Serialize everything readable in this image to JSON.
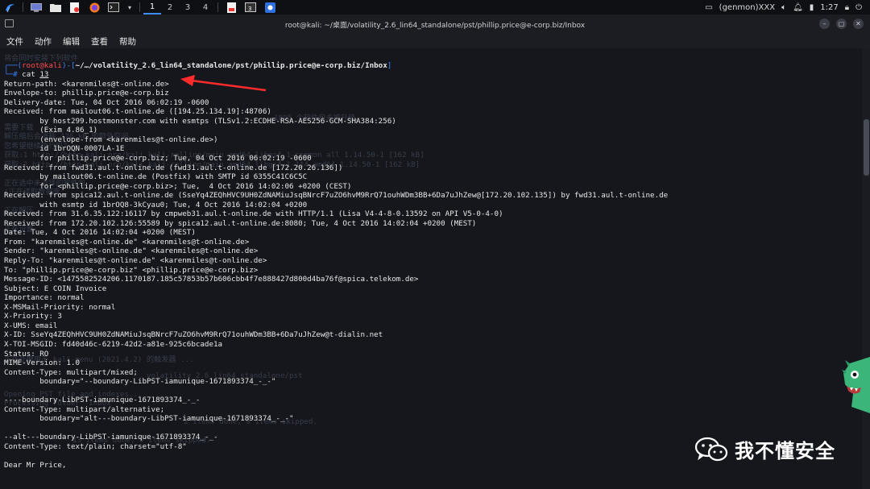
{
  "taskbar": {
    "workspaces": [
      "1",
      "2",
      "3",
      "4"
    ],
    "active_workspace": "1",
    "notif_count": "3",
    "user": "(genmon)XXX",
    "time": "1:27"
  },
  "window": {
    "title": "root@kali: ~/桌面/volatility_2.6_lin64_standalone/pst/phillip.price@e-corp.biz/Inbox"
  },
  "menu": [
    "文件",
    "动作",
    "编辑",
    "查看",
    "帮助"
  ],
  "prompt": {
    "user": "root@kali",
    "path": "~/…/volatility_2.6_lin64_standalone/pst/phillip.price@e-corp.biz/Inbox",
    "symbol": "#",
    "command": "cat",
    "argument": "13"
  },
  "output": [
    "Return-path: <karenmiles@t-online.de>",
    "Envelope-to: phillip.price@e-corp.biz",
    "Delivery-date: Tue, 04 Oct 2016 06:02:19 -0600",
    "Received: from mailout06.t-online.de ([194.25.134.19]:48706)",
    "        by host299.hostmonster.com with esmtps (TLSv1.2:ECDHE-RSA-AES256-GCM-SHA384:256)",
    "        (Exim 4.86_1)",
    "        (envelope-from <karenmiles@t-online.de>)",
    "        id 1brOQN-0007LA-1E",
    "        for phillip.price@e-corp.biz; Tue, 04 Oct 2016 06:02:19 -0600",
    "Received: from fwd31.aul.t-online.de (fwd31.aul.t-online.de [172.20.26.136])",
    "        by mailout06.t-online.de (Postfix) with SMTP id 6355C41C6C5C",
    "        for <phillip.price@e-corp.biz>; Tue,  4 Oct 2016 14:02:06 +0200 (CEST)",
    "Received: from spica12.aul.t-online.de (SseYq4ZEQhHVC9UH0ZdNAMiuJsqBNrcF7uZO6hvM9RrQ71ouhWDm3BB+6Da7uJhZew@[172.20.102.135]) by fwd31.aul.t-online.de",
    "        with esmtp id 1brOQ8-3kCyau0; Tue, 4 Oct 2016 14:02:04 +0200",
    "Received: from 31.6.35.122:16117 by cmpweb31.aul.t-online.de with HTTP/1.1 (Lisa V4-4-8-0.13592 on API V5-0-4-0)",
    "Received: from 172.20.102.126:55589 by spica12.aul.t-online.de:8080; Tue, 4 Oct 2016 14:02:04 +0200 (MEST)",
    "Date: Tue, 4 Oct 2016 14:02:04 +0200 (MEST)",
    "From: \"karenmiles@t-online.de\" <karenmiles@t-online.de>",
    "Sender: \"karenmiles@t-online.de\" <karenmiles@t-online.de>",
    "Reply-To: \"karenmiles@t-online.de\" <karenmiles@t-online.de>",
    "To: \"phillip.price@e-corp.biz\" <phillip.price@e-corp.biz>",
    "Message-ID: <1475582524206.1170187.185c57853b57b606cbb4f7e888427d800d4ba76f@spica.telekom.de>",
    "Subject: E COIN Invoice",
    "Importance: normal",
    "X-MSMail-Priority: normal",
    "X-Priority: 3",
    "X-UMS: email",
    "X-ID: SseYq4ZEQhHVC9UH0ZdNAMiuJsqBNrcF7uZO6hvM9RrQ71ouhWDm3BB+6Da7uJhZew@t-dialin.net",
    "X-TOI-MSGID: fd40d46c-6219-42d2-a81e-925c6bcade1a",
    "Status: RO",
    "MIME-Version: 1.0",
    "Content-Type: multipart/mixed;",
    "        boundary=\"--boundary-LibPST-iamunique-1671893374_-_-\"",
    "",
    "----boundary-LibPST-iamunique-1671893374_-_-",
    "Content-Type: multipart/alternative;",
    "        boundary=\"alt---boundary-LibPST-iamunique-1671893374_-_-\"",
    "",
    "--alt---boundary-LibPST-iamunique-1671893374_-_-",
    "Content-Type: text/plain; charset=\"utf-8\"",
    "",
    "Dear Mr Price,"
  ],
  "ghost_text": [
    "将会同时安装下列软件",
    "1895 个软件包未被升级。",
    "需要下载",
    "解压缩后会消耗 126 kB 的额外空间。",
    "您希望继续执行吗？",
    "获取:1 http://http.kali.org/kali kali-rolling/main amd64 libgsf-1-common all 1.14.50-1 [162 kB]",
    "获取:2 http://http.kali.org/kali kali-rolling/main amd64 libgsf-1-114 amd64 1.14.50-1 [162 kB]",
    "正在选中未选择的软件包",
    "(正在读取数据库 ...",
    "正在解压",
    "正在设置",
    "正在处理用于 kali-menu (2021.4.2) 的触发器 ...",
    "volatility_2.6_lin64_standalone/pst",
    "Opening PST file and indexes...",
    "Processing Folder \"Inbox\"",
    "2 items done, 0 items skipped.",
    "13 items done, 0 items skipped."
  ],
  "watermark": {
    "text": "我不懂安全"
  },
  "colors": {
    "background": "#15171d",
    "prompt_blue": "#3b82f6",
    "prompt_red": "#ff4d4d",
    "arrow": "#ff2a2a",
    "accent": "#3d8dff"
  }
}
